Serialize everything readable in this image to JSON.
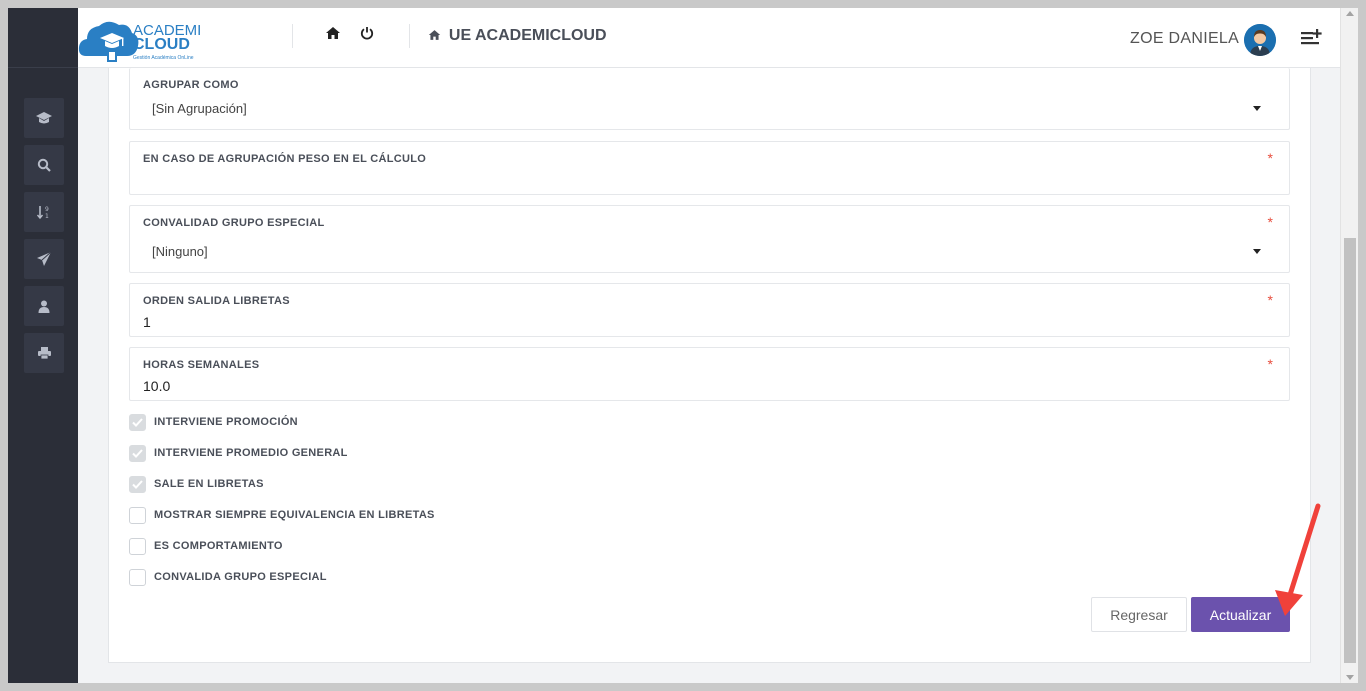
{
  "header": {
    "logo": {
      "line1": "ACADEMI",
      "line2": "CLOUD",
      "tagline": "Gestión Académica OnLine"
    },
    "school_name": "UE ACADEMICLOUD",
    "user_name": "ZOE DANIELA"
  },
  "sidebar": {
    "items": [
      {
        "icon": "graduation-cap-icon"
      },
      {
        "icon": "search-icon"
      },
      {
        "icon": "sort-numeric-icon"
      },
      {
        "icon": "send-icon"
      },
      {
        "icon": "user-icon"
      },
      {
        "icon": "print-icon"
      }
    ]
  },
  "form": {
    "agrupar": {
      "label": "AGRUPAR COMO",
      "value": "[Sin Agrupación]"
    },
    "peso": {
      "label": "EN CASO DE AGRUPACIÓN PESO EN EL CÁLCULO",
      "required": "*",
      "value": ""
    },
    "convalidad": {
      "label": "CONVALIDAD GRUPO ESPECIAL",
      "required": "*",
      "value": "[Ninguno]"
    },
    "orden": {
      "label": "ORDEN SALIDA LIBRETAS",
      "required": "*",
      "value": "1"
    },
    "horas": {
      "label": "HORAS SEMANALES",
      "required": "*",
      "value": "10.0"
    },
    "checkboxes": [
      {
        "label": "INTERVIENE PROMOCIÓN",
        "checked": true
      },
      {
        "label": "INTERVIENE PROMEDIO GENERAL",
        "checked": true
      },
      {
        "label": "SALE EN LIBRETAS",
        "checked": true
      },
      {
        "label": "MOSTRAR SIEMPRE EQUIVALENCIA EN LIBRETAS",
        "checked": false
      },
      {
        "label": "ES COMPORTAMIENTO",
        "checked": false
      },
      {
        "label": "CONVALIDA GRUPO ESPECIAL",
        "checked": false
      }
    ],
    "buttons": {
      "back": "Regresar",
      "save": "Actualizar"
    }
  },
  "colors": {
    "primary_button": "#6b52ad",
    "sidebar": "#2b2e38",
    "required": "#e74c3c",
    "annotation_arrow": "#f0413a"
  }
}
